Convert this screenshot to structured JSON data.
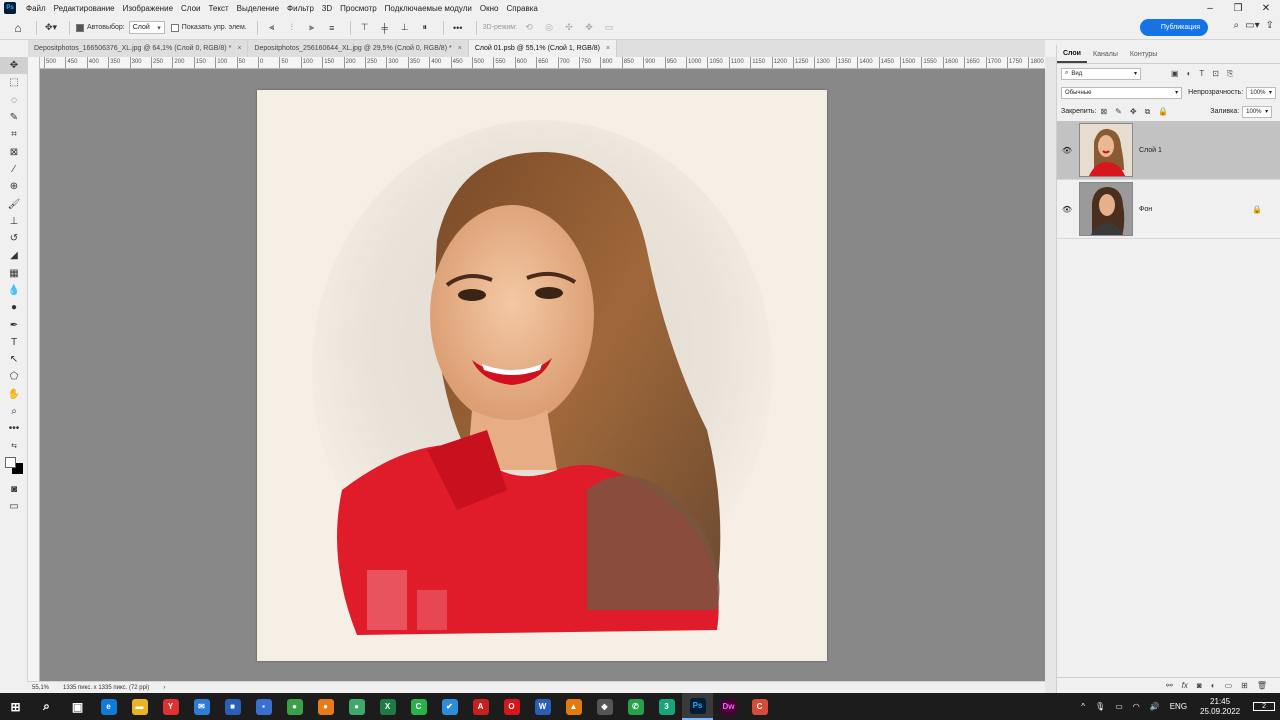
{
  "app": {
    "logo": "Ps"
  },
  "menu": [
    "Файл",
    "Редактирование",
    "Изображение",
    "Слои",
    "Текст",
    "Выделение",
    "Фильтр",
    "3D",
    "Просмотр",
    "Подключаемые модули",
    "Окно",
    "Справка"
  ],
  "options_bar": {
    "autoselect_label": "Автовыбор:",
    "autoselect_value": "Слой",
    "show_transform_label": "Показать упр. элем.",
    "mode_3d_label": "3D-режим:",
    "share_label": "Публикация"
  },
  "doc_tabs": [
    {
      "label": "Depositphotos_166506376_XL.jpg @ 64,1% (Слой 0, RGB/8) *",
      "close": "×"
    },
    {
      "label": "Depositphotos_256160644_XL.jpg @ 29,5% (Слой 0, RGB/8) *",
      "close": "×"
    },
    {
      "label": "Слой 01.psb @ 55,1% (Слой 1, RGB/8)",
      "close": "×"
    }
  ],
  "ruler_ticks": [
    "500",
    "450",
    "400",
    "350",
    "300",
    "250",
    "200",
    "150",
    "100",
    "50",
    "0",
    "50",
    "100",
    "150",
    "200",
    "250",
    "300",
    "350",
    "400",
    "450",
    "500",
    "550",
    "600",
    "650",
    "700",
    "750",
    "800",
    "850",
    "900",
    "950",
    "1000",
    "1050",
    "1100",
    "1150",
    "1200",
    "1250",
    "1300",
    "1350",
    "1400",
    "1450",
    "1500",
    "1550",
    "1600",
    "1650",
    "1700",
    "1750",
    "1800"
  ],
  "status": {
    "zoom": "55,1%",
    "size": "1335 пикс. x 1335 пикс. (72 ppi)",
    "arrow": "›"
  },
  "layers_panel": {
    "tabs": [
      "Слои",
      "Каналы",
      "Контуры"
    ],
    "filter_value": "Вид",
    "blend_mode": "Обычные",
    "opacity_label": "Непрозрачность:",
    "opacity_value": "100%",
    "lock_label": "Закрепить:",
    "fill_label": "Заливка:",
    "fill_value": "100%",
    "layers": [
      {
        "name": "Слой 1",
        "selected": true
      },
      {
        "name": "Фон",
        "selected": false
      }
    ]
  },
  "taskbar": {
    "lang": "ENG",
    "time": "21:45",
    "date": "25.09.2022",
    "notification_count": "2",
    "apps": [
      {
        "icon": "start-icon",
        "glyph": "⊞",
        "color": "#1c1c1c"
      },
      {
        "icon": "search-icon",
        "glyph": "⌕",
        "color": "#1c1c1c"
      },
      {
        "icon": "task-view-icon",
        "glyph": "▣",
        "color": "#1c1c1c"
      },
      {
        "icon": "edge-icon",
        "glyph": "e",
        "color": "#0f7bd6"
      },
      {
        "icon": "explorer-icon",
        "glyph": "▬",
        "color": "#e8b325"
      },
      {
        "icon": "yandex-icon",
        "glyph": "Y",
        "color": "#e03030"
      },
      {
        "icon": "mail-icon",
        "glyph": "✉",
        "color": "#2e7cd6"
      },
      {
        "icon": "store-icon",
        "glyph": "■",
        "color": "#2b5fb5"
      },
      {
        "icon": "floppy-icon",
        "glyph": "▪",
        "color": "#3a6fd0"
      },
      {
        "icon": "chrome-icon",
        "glyph": "●",
        "color": "#3aa14a"
      },
      {
        "icon": "firefox-icon",
        "glyph": "●",
        "color": "#e87a1c"
      },
      {
        "icon": "camtasia-icon",
        "glyph": "●",
        "color": "#3fa86b"
      },
      {
        "icon": "excel-icon",
        "glyph": "X",
        "color": "#1e7b45"
      },
      {
        "icon": "c-green-icon",
        "glyph": "C",
        "color": "#27b24a"
      },
      {
        "icon": "check-icon",
        "glyph": "✔",
        "color": "#2a8fd8"
      },
      {
        "icon": "pdf-icon",
        "glyph": "A",
        "color": "#c8201d"
      },
      {
        "icon": "opera-icon",
        "glyph": "O",
        "color": "#d6161d"
      },
      {
        "icon": "word-icon",
        "glyph": "W",
        "color": "#2b5fb5"
      },
      {
        "icon": "vlc-icon",
        "glyph": "▲",
        "color": "#e07b12"
      },
      {
        "icon": "paint-icon",
        "glyph": "◆",
        "color": "#555555"
      },
      {
        "icon": "phone-icon",
        "glyph": "✆",
        "color": "#25a04b"
      },
      {
        "icon": "app3-icon",
        "glyph": "3",
        "color": "#1aa37d"
      },
      {
        "icon": "photoshop-icon",
        "glyph": "Ps",
        "color": "#001e36"
      },
      {
        "icon": "dreamweaver-icon",
        "glyph": "Dw",
        "color": "#470137"
      },
      {
        "icon": "c-red-icon",
        "glyph": "C",
        "color": "#d84a3a"
      }
    ]
  }
}
